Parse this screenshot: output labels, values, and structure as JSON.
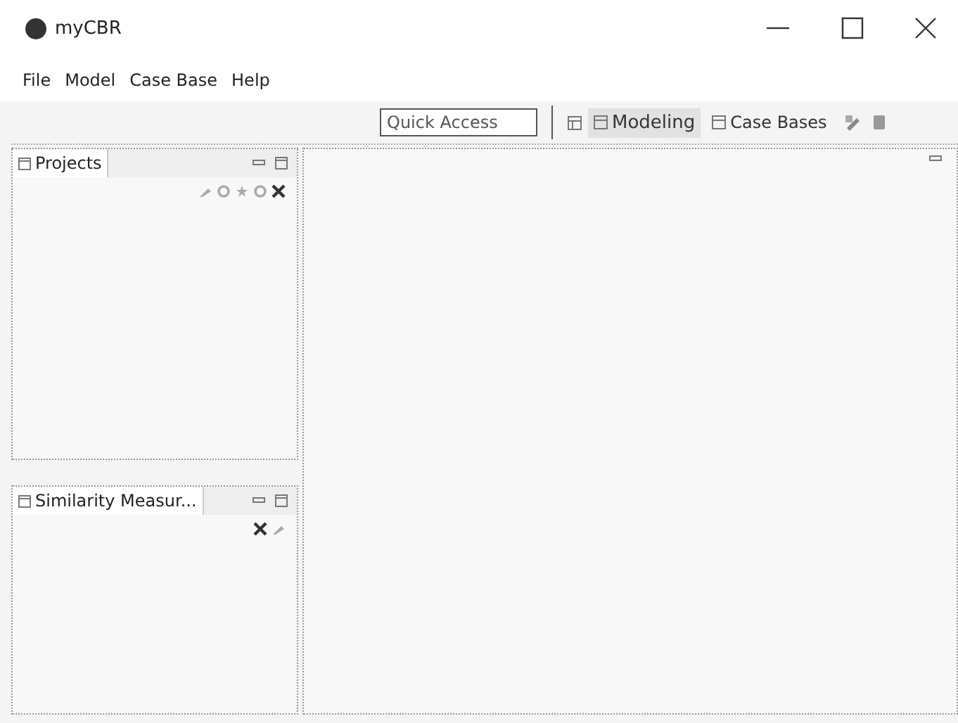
{
  "window": {
    "title": "myCBR"
  },
  "menu": [
    "File",
    "Model",
    "Case Base",
    "Help"
  ],
  "toolbar": {
    "quick_access": {
      "placeholder": "Quick Access"
    },
    "perspectives": [
      {
        "label": "Modeling",
        "selected": true
      },
      {
        "label": "Case Bases",
        "selected": false
      }
    ]
  },
  "panels": [
    {
      "title": "Projects",
      "tools": [
        {
          "kind": "edit"
        },
        {
          "kind": "settings"
        },
        {
          "kind": "new"
        },
        {
          "kind": "settings"
        },
        {
          "kind": "close"
        }
      ]
    },
    {
      "title": "Similarity Measur...",
      "tools": [
        {
          "kind": "close"
        },
        {
          "kind": "edit"
        }
      ]
    }
  ]
}
